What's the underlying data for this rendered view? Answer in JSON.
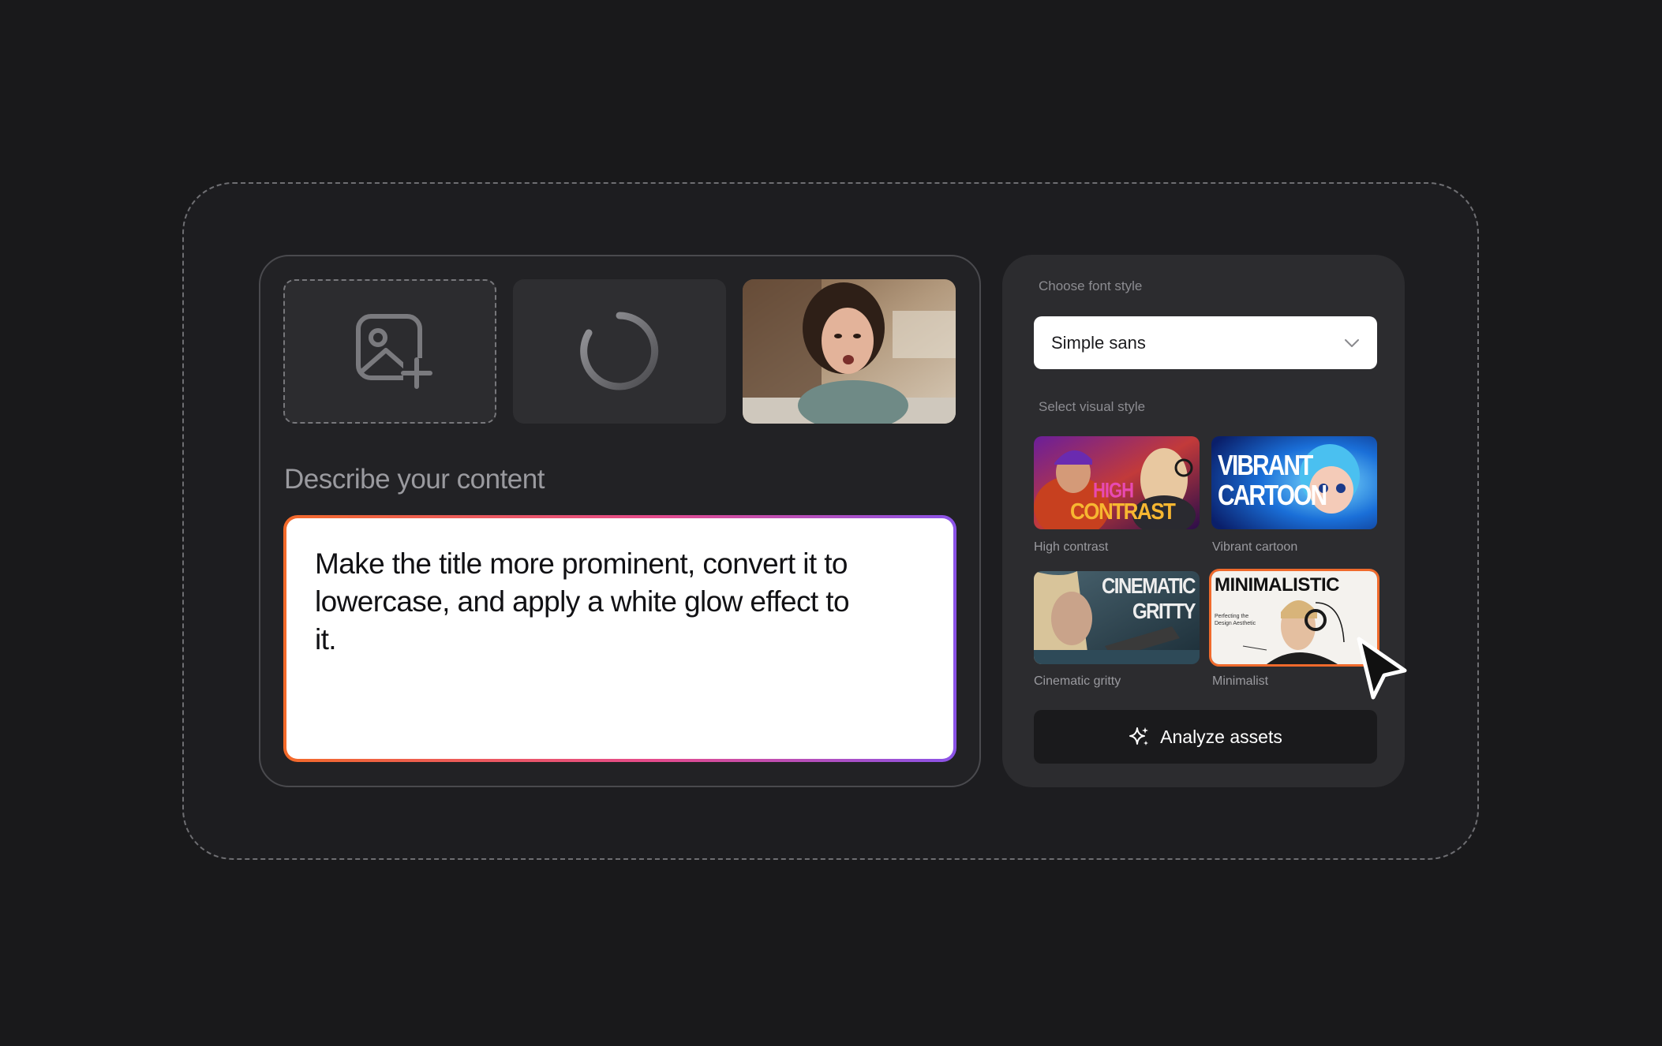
{
  "composer": {
    "describe_label": "Describe your content",
    "prompt_text": "Make the title more prominent, convert it to lowercase, and apply a white glow effect to it."
  },
  "sidebar": {
    "font_label": "Choose font style",
    "font_value": "Simple sans",
    "visual_label": "Select visual style",
    "styles": [
      {
        "caption": "High contrast",
        "thumb_text": [
          "HIGH",
          "CONTRAST"
        ]
      },
      {
        "caption": "Vibrant cartoon",
        "thumb_text": [
          "VIBRANT",
          "CARTOON"
        ]
      },
      {
        "caption": "Cinematic gritty",
        "thumb_text": [
          "CINEMATIC",
          "GRITTY"
        ]
      },
      {
        "caption": "Minimalist",
        "thumb_text": [
          "MINIMALISTIC",
          "Perfecting the",
          "Design Aesthetic"
        ]
      }
    ],
    "analyze_label": "Analyze assets"
  },
  "colors": {
    "accent_orange": "#f36a2a",
    "accent_pink": "#e54b8c",
    "accent_purple": "#8a53e8",
    "background": "#19191b"
  },
  "icons": [
    "image-add-icon",
    "loading-spinner-icon",
    "chevron-down-icon",
    "sparkle-icon",
    "cursor-icon"
  ]
}
